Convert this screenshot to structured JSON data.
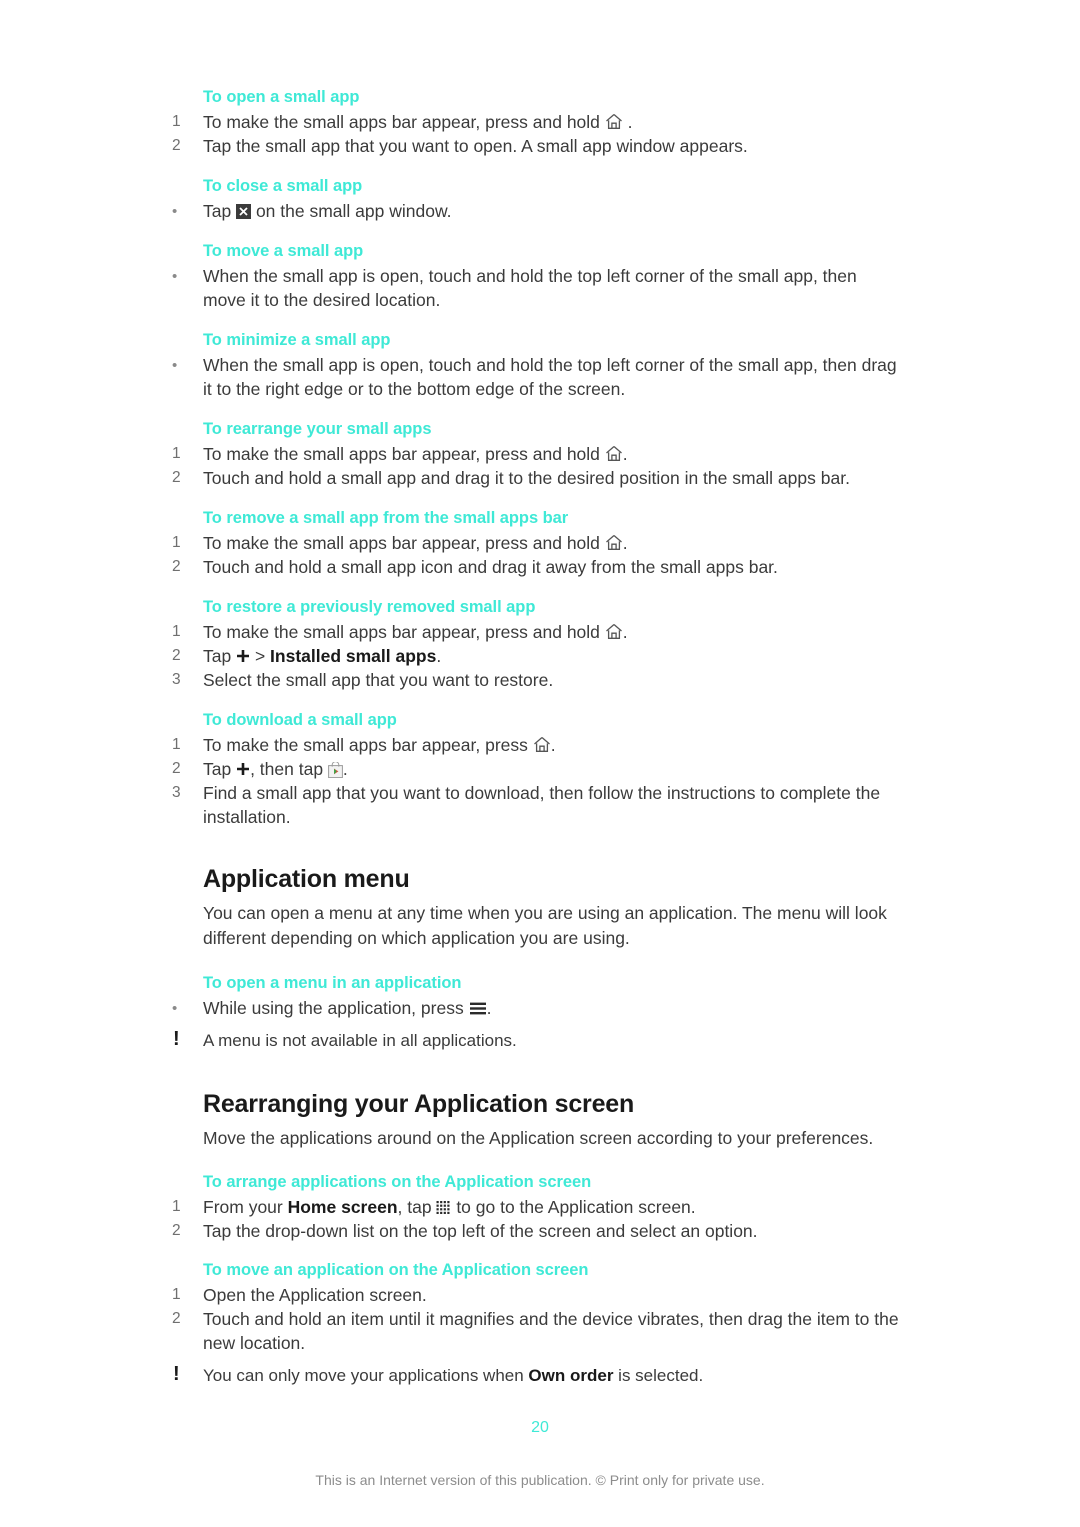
{
  "document": {
    "page_number": "20",
    "footer_note": "This is an Internet version of this publication. © Print only for private use.",
    "heading_color": "#3fe9d6"
  },
  "blocks": [
    {
      "title": "To open a small app",
      "steps": [
        {
          "marker": "1",
          "pre": "To make the small apps bar appear, press and hold ",
          "icon": "home-icon",
          "post": " ."
        },
        {
          "marker": "2",
          "pre": "Tap the small app that you want to open. A small app window appears."
        }
      ]
    },
    {
      "title": "To close a small app",
      "steps": [
        {
          "marker": "•",
          "pre": "Tap ",
          "icon": "close-icon",
          "post": " on the small app window."
        }
      ]
    },
    {
      "title": "To move a small app",
      "steps": [
        {
          "marker": "•",
          "pre": "When the small app is open, touch and hold the top left corner of the small app, then move it to the desired location."
        }
      ]
    },
    {
      "title": "To minimize a small app",
      "steps": [
        {
          "marker": "•",
          "pre": "When the small app is open, touch and hold the top left corner of the small app, then drag it to the right edge or to the bottom edge of the screen."
        }
      ]
    },
    {
      "title": "To rearrange your small apps",
      "steps": [
        {
          "marker": "1",
          "pre": "To make the small apps bar appear, press and hold ",
          "icon": "home-icon",
          "post": "."
        },
        {
          "marker": "2",
          "pre": "Touch and hold a small app and drag it to the desired position in the small apps bar."
        }
      ]
    },
    {
      "title": "To remove a small app from the small apps bar",
      "steps": [
        {
          "marker": "1",
          "pre": "To make the small apps bar appear, press and hold ",
          "icon": "home-icon",
          "post": "."
        },
        {
          "marker": "2",
          "pre": "Touch and hold a small app icon and drag it away from the small apps bar."
        }
      ]
    },
    {
      "title": "To restore a previously removed small app",
      "steps": [
        {
          "marker": "1",
          "pre": "To make the small apps bar appear, press and hold ",
          "icon": "home-icon",
          "post": "."
        },
        {
          "marker": "2",
          "pre": "Tap ",
          "icon": "plus-icon",
          "post": " > ",
          "bold": "Installed small apps",
          "tail": "."
        },
        {
          "marker": "3",
          "pre": "Select the small app that you want to restore."
        }
      ]
    },
    {
      "title": "To download a small app",
      "steps": [
        {
          "marker": "1",
          "pre": "To make the small apps bar appear, press ",
          "icon": "home-icon",
          "post": "."
        },
        {
          "marker": "2",
          "pre": "Tap ",
          "icon": "plus-icon",
          "post": ", then tap ",
          "icon2": "play-store-icon",
          "tail": "."
        },
        {
          "marker": "3",
          "pre": "Find a small app that you want to download, then follow the instructions to complete the installation."
        }
      ]
    }
  ],
  "section_application_menu": {
    "title": "Application menu",
    "intro": "You can open a menu at any time when you are using an application. The menu will look different depending on which application you are using.",
    "task": {
      "title": "To open a menu in an application",
      "steps": [
        {
          "marker": "•",
          "pre": "While using the application, press ",
          "icon": "menu-icon",
          "post": "."
        }
      ]
    },
    "note": "A menu is not available in all applications.",
    "note_icon": "!"
  },
  "section_rearranging": {
    "title": "Rearranging your Application screen",
    "intro": "Move the applications around on the Application screen according to your preferences.",
    "task_arrange": {
      "title": "To arrange applications on the Application screen",
      "steps": [
        {
          "marker": "1",
          "pre": "From your ",
          "bold": "Home screen",
          "post": ", tap ",
          "icon2": "app-grid-icon",
          "tail": " to go to the Application screen."
        },
        {
          "marker": "2",
          "pre": "Tap the drop-down list on the top left of the screen and select an option."
        }
      ]
    },
    "task_move": {
      "title": "To move an application on the Application screen",
      "steps": [
        {
          "marker": "1",
          "pre": "Open the Application screen."
        },
        {
          "marker": "2",
          "pre": "Touch and hold an item until it magnifies and the device vibrates, then drag the item to the new location."
        }
      ]
    },
    "note_pre": "You can only move your applications when ",
    "note_bold": "Own order",
    "note_post": " is selected.",
    "note_icon": "!"
  }
}
